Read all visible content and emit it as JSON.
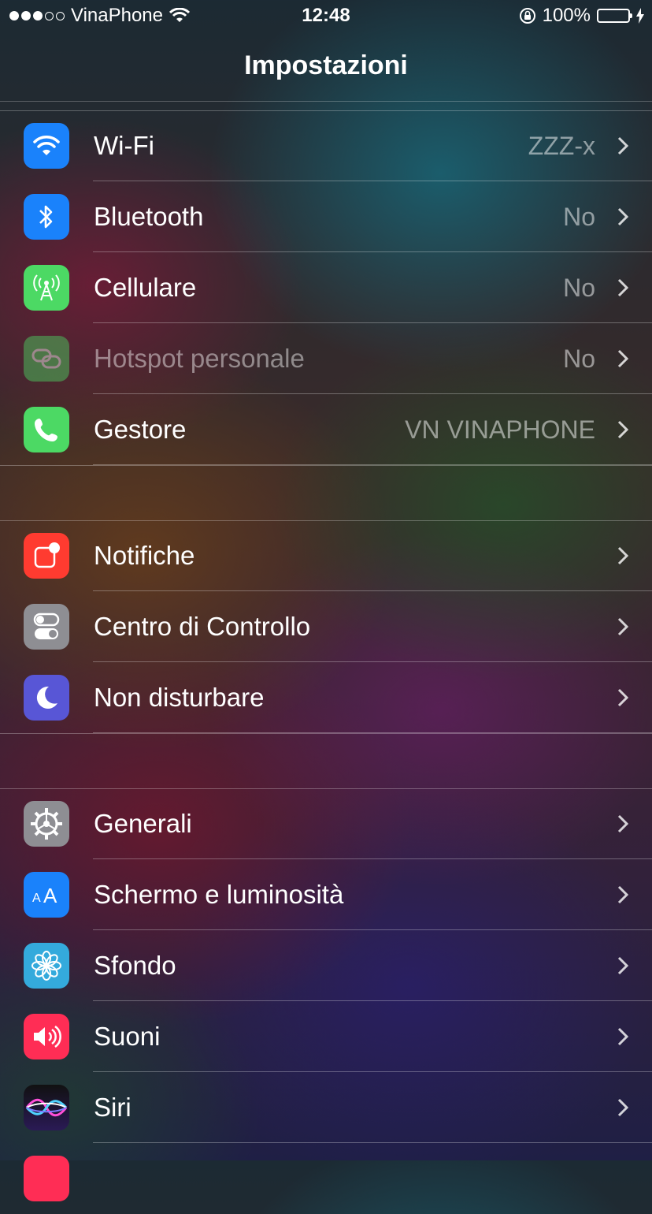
{
  "status_bar": {
    "carrier": "VinaPhone",
    "time": "12:48",
    "battery_percent": "100%",
    "battery_level": 1.0,
    "signal_bars_filled": 3,
    "signal_bars_total": 5
  },
  "nav": {
    "title": "Impostazioni"
  },
  "groups": [
    {
      "items": [
        {
          "label": "Wi-Fi",
          "value": "ZZZ-x",
          "icon": "wifi-icon",
          "color": "#1a82fb",
          "enabled": true
        },
        {
          "label": "Bluetooth",
          "value": "No",
          "icon": "bluetooth-icon",
          "color": "#1a82fb",
          "enabled": true
        },
        {
          "label": "Cellulare",
          "value": "No",
          "icon": "cellular-antenna-icon",
          "color": "#4cd964",
          "enabled": true
        },
        {
          "label": "Hotspot personale",
          "value": "No",
          "icon": "hotspot-chain-icon",
          "color": "#4cd964",
          "enabled": false
        },
        {
          "label": "Gestore",
          "value": "VN VINAPHONE",
          "icon": "phone-icon",
          "color": "#4cd964",
          "enabled": true
        }
      ]
    },
    {
      "items": [
        {
          "label": "Notifiche",
          "value": "",
          "icon": "notifications-icon",
          "color": "#ff3b30",
          "enabled": true
        },
        {
          "label": "Centro di Controllo",
          "value": "",
          "icon": "control-center-toggles-icon",
          "color": "#8e8e93",
          "enabled": true
        },
        {
          "label": "Non disturbare",
          "value": "",
          "icon": "moon-icon",
          "color": "#5856d6",
          "enabled": true
        }
      ]
    },
    {
      "items": [
        {
          "label": "Generali",
          "value": "",
          "icon": "gear-icon",
          "color": "#8e8e93",
          "enabled": true
        },
        {
          "label": "Schermo e luminosità",
          "value": "",
          "icon": "text-size-icon",
          "color": "#1a82fb",
          "enabled": true
        },
        {
          "label": "Sfondo",
          "value": "",
          "icon": "wallpaper-flower-icon",
          "color": "#34aadc",
          "enabled": true
        },
        {
          "label": "Suoni",
          "value": "",
          "icon": "speaker-icon",
          "color": "#ff2d55",
          "enabled": true
        },
        {
          "label": "Siri",
          "value": "",
          "icon": "siri-icon",
          "color": "#222233",
          "enabled": true
        }
      ]
    }
  ]
}
